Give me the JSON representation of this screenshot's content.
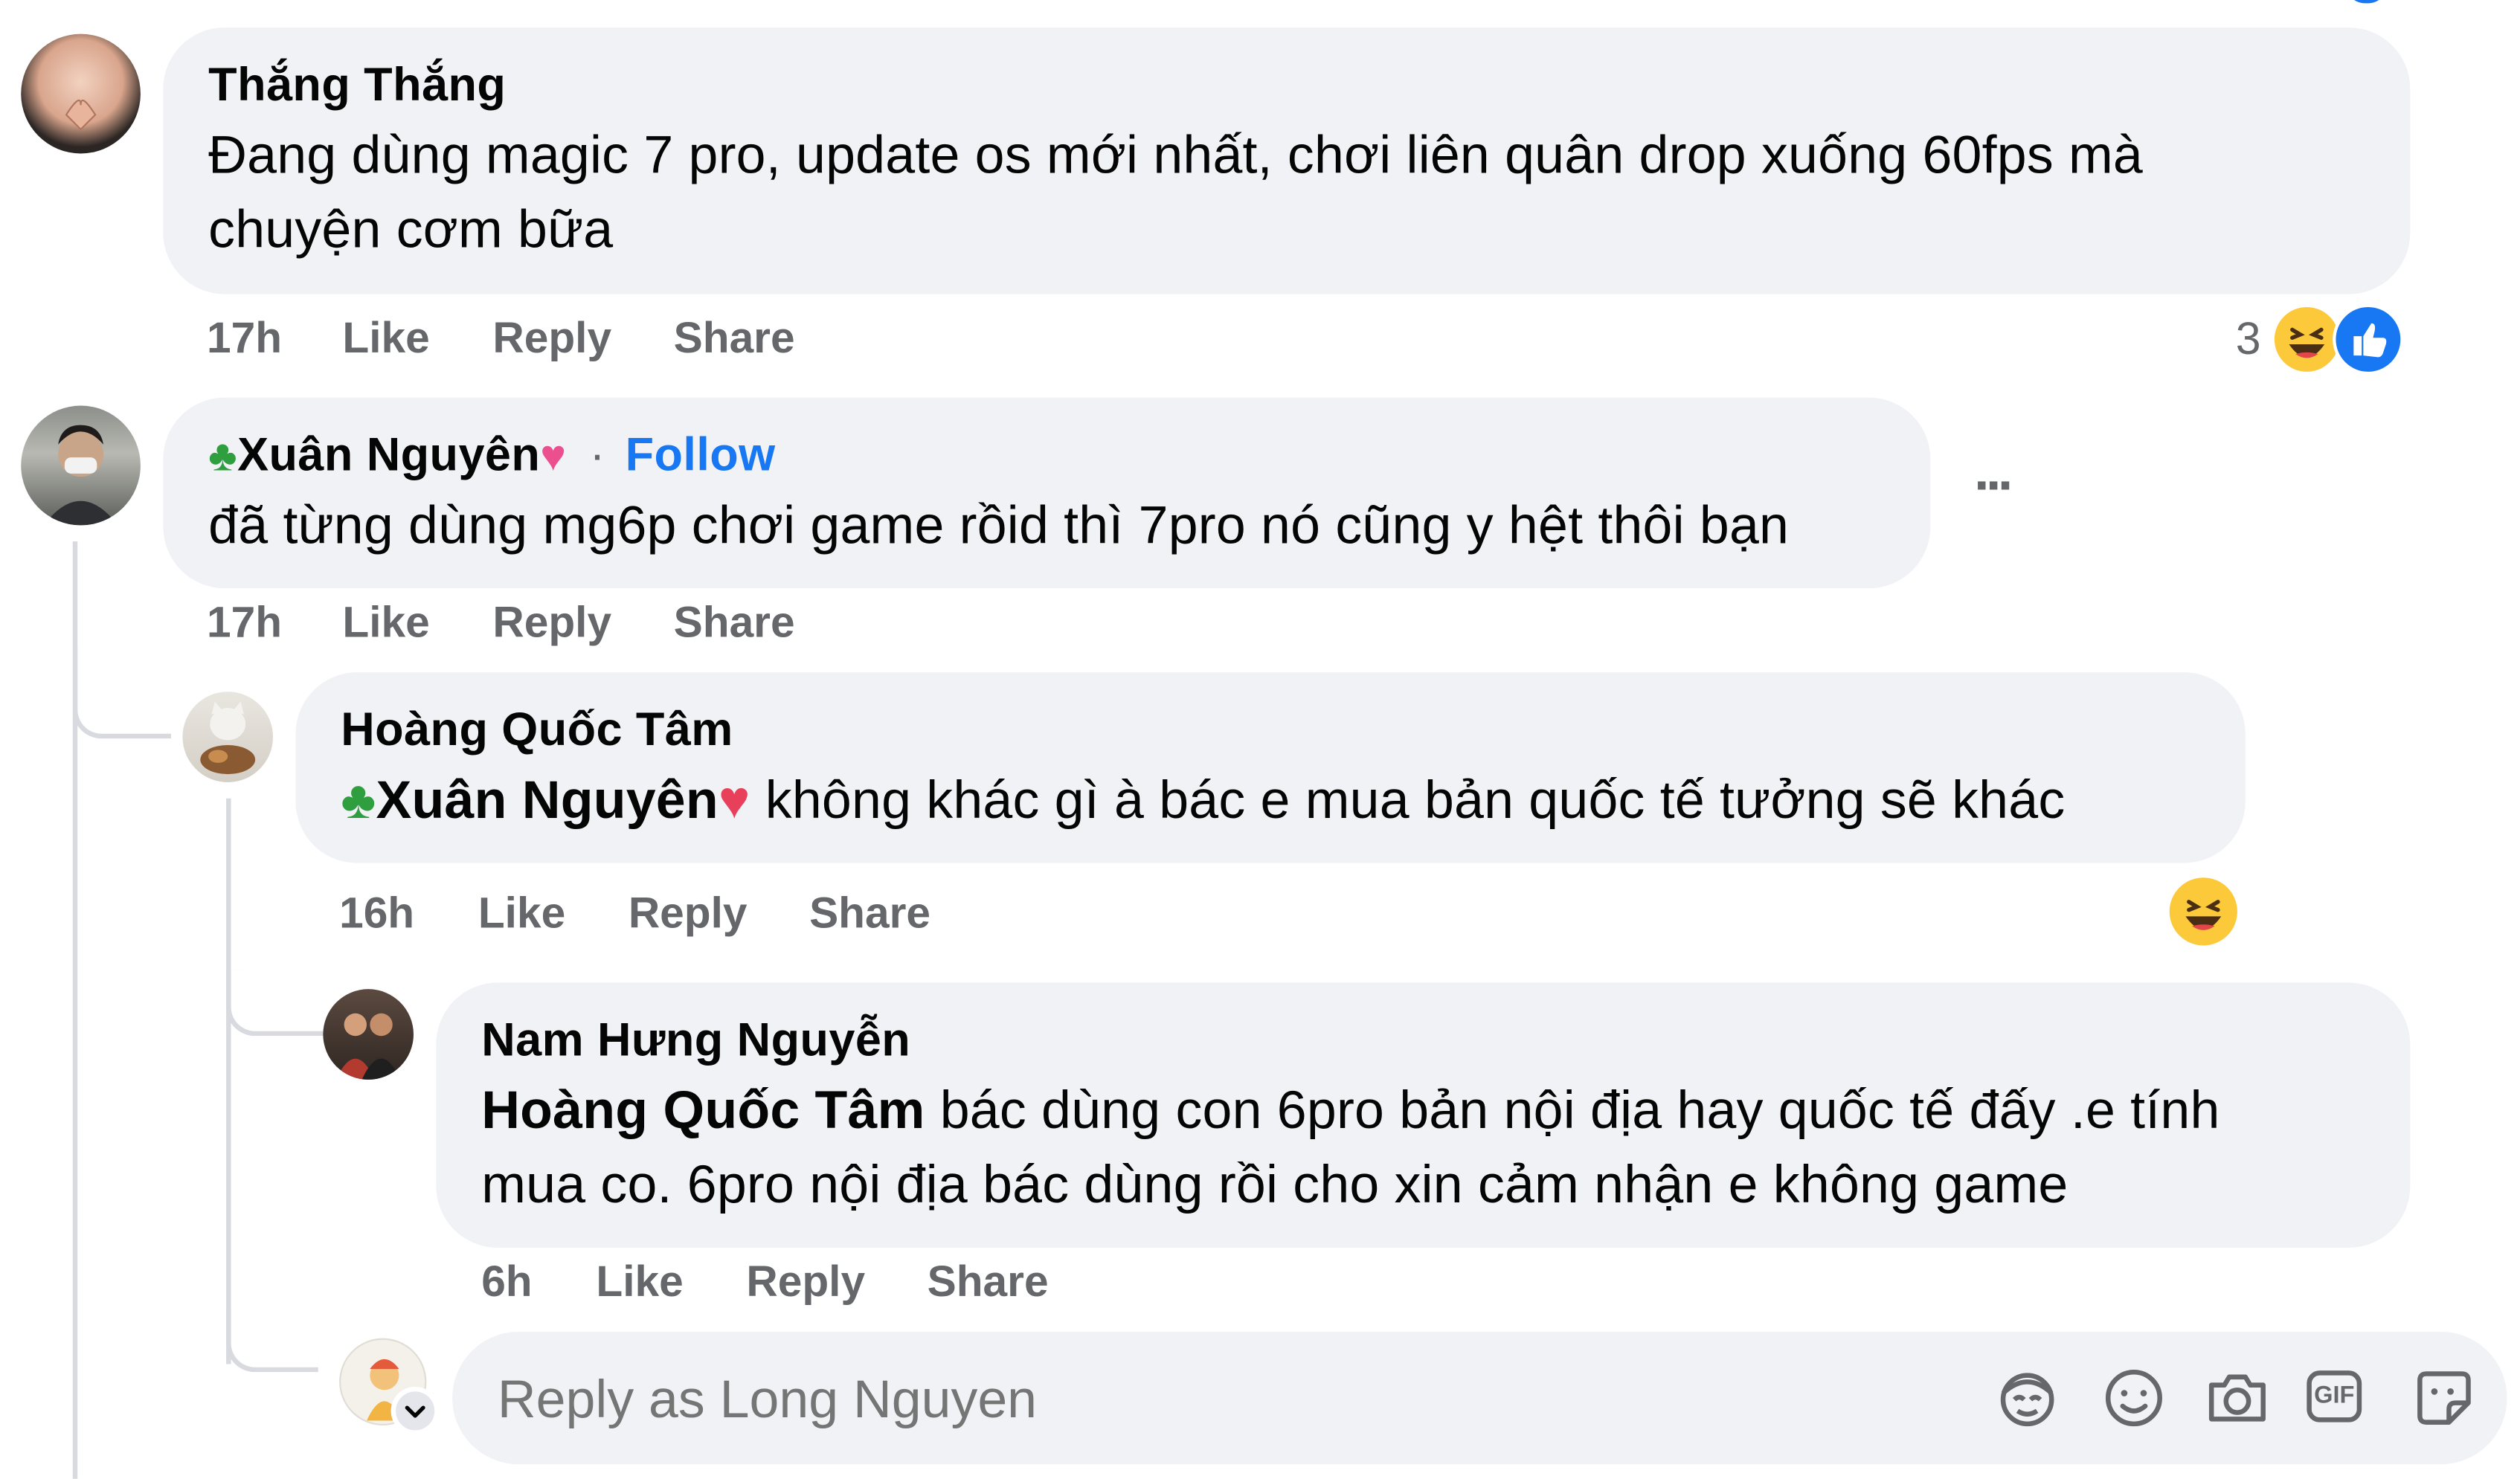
{
  "comments": [
    {
      "author": "Thắng Thắng",
      "text_line1": "Đang dùng magic 7 pro, update os mới nhất, chơi liên quân drop xuống 60fps mà",
      "text_line2": "chuyện cơm bữa",
      "time": "17h",
      "like": "Like",
      "reply": "Reply",
      "share": "Share",
      "reaction_count": "3"
    },
    {
      "author": "Xuân Nguyên",
      "follow_sep": "·",
      "follow": "Follow",
      "text": "đã từng dùng mg6p chơi game rồid thì 7pro nó cũng y hệt thôi bạn",
      "time": "17h",
      "like": "Like",
      "reply": "Reply",
      "share": "Share",
      "more": "···"
    },
    {
      "author": "Hoàng Quốc Tâm",
      "mention": "Xuân Nguyên",
      "text": " không khác gì à bác e mua bản quốc tế tưởng sẽ khác",
      "time": "16h",
      "like": "Like",
      "reply": "Reply",
      "share": "Share"
    },
    {
      "author": "Nam Hưng Nguyễn",
      "mention": "Hoàng Quốc Tâm",
      "text_line1": " bác dùng con 6pro bản nội địa hay quốc tế đấy .e tính",
      "text_line2": "mua co. 6pro nội địa bác dùng rồi cho xin cảm nhận e không game",
      "time": "6h",
      "like": "Like",
      "reply": "Reply",
      "share": "Share"
    }
  ],
  "reply_box": {
    "placeholder": "Reply as Long Nguyen",
    "gif_label": "GIF"
  },
  "colors": {
    "bubble": "#f0f2f5",
    "meta_text": "#65676b",
    "link_blue": "#1877f2",
    "thread_line": "#d8dadf"
  }
}
